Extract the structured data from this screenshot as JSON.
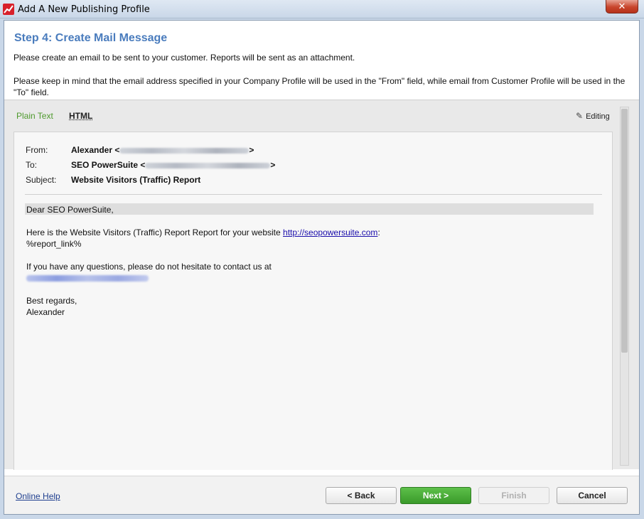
{
  "window": {
    "title": "Add A New Publishing Profile",
    "close_label": "✕"
  },
  "header": {
    "step_title": "Step 4: Create Mail Message",
    "description": "Please create an email to be sent to your customer. Reports will be sent as an attachment.",
    "note": "Please keep in mind that the email address specified in your Company Profile will be used in the \"From\" field, while email from Customer Profile will be used in the \"To\" field."
  },
  "editor": {
    "tab_plain": "Plain Text",
    "tab_html": "HTML",
    "editing_label": "Editing"
  },
  "mail": {
    "from_label": "From:",
    "from_name": "Alexander <",
    "from_close": ">",
    "to_label": "To:",
    "to_name": "SEO PowerSuite <",
    "to_close": ">",
    "subject_label": "Subject:",
    "subject_value": "Website Visitors (Traffic) Report",
    "greeting": "Dear SEO PowerSuite,",
    "line1_prefix": "Here is the Website Visitors (Traffic) Report Report for your website ",
    "line1_link": "http://seopowersuite.com",
    "line1_suffix": ":",
    "report_link": "%report_link%",
    "contact_line": "If you have any questions, please do not hesitate to contact us at",
    "closing": "Best regards,",
    "signature": "Alexander"
  },
  "footer": {
    "online_help": "Online Help",
    "back": "< Back",
    "next": "Next >",
    "finish": "Finish",
    "cancel": "Cancel"
  }
}
